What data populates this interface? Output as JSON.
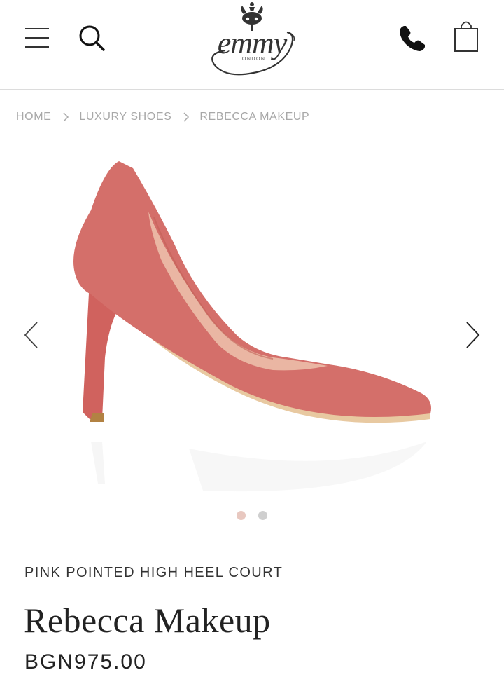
{
  "header": {
    "menu_icon": "hamburger-menu-icon",
    "search_icon": "search-icon",
    "logo_text": "emmy",
    "logo_subtext": "LONDON",
    "phone_icon": "phone-icon",
    "bag_icon": "shopping-bag-icon"
  },
  "breadcrumb": {
    "items": [
      "HOME",
      "LUXURY SHOES",
      "REBECCA MAKEUP"
    ]
  },
  "gallery": {
    "prev_icon": "chevron-left-icon",
    "next_icon": "chevron-right-icon",
    "active_index": 0,
    "dots": [
      {
        "color": "#e8c8c0"
      },
      {
        "color": "#cfcfcf"
      }
    ],
    "shoe_color": "#d46f6a"
  },
  "product": {
    "subtitle": "PINK POINTED HIGH HEEL COURT",
    "name": "Rebecca Makeup",
    "price": "BGN975.00"
  }
}
